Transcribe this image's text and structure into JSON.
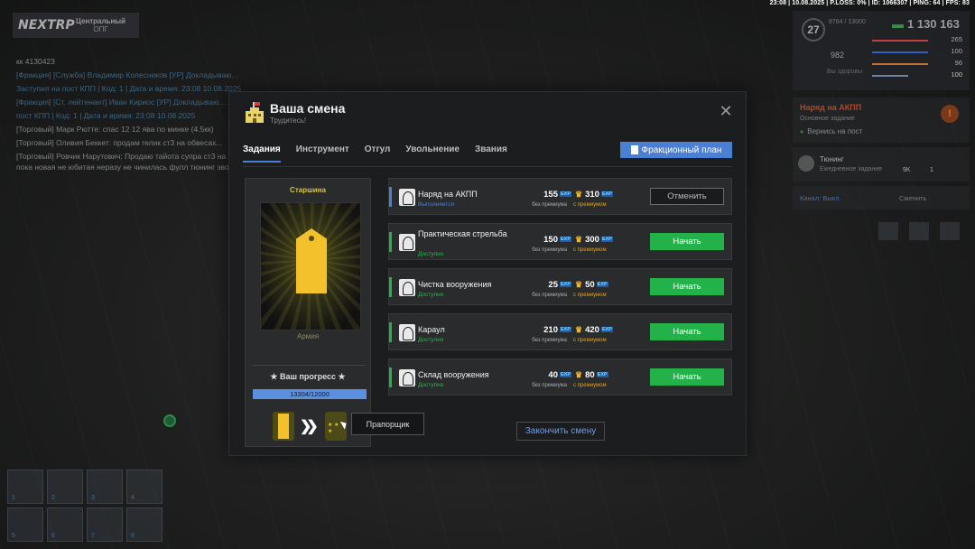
{
  "status": "23:08 | 10.08.2025 | P.LOSS: 0% | ID: 1066307 | PING: 64 | FPS: 83",
  "logo": {
    "text": "NEXTRP",
    "line1": "Центральный",
    "line2": "ОПГ"
  },
  "chat": {
    "lines": [
      {
        "text": "кк 4130423",
        "cls": ""
      },
      {
        "text": "[Фракция] [Служба] Владимир Колесников [УР] Докладываю...",
        "cls": "blue"
      },
      {
        "text": "Заступил на пост КПП | Код: 1 | Дата и время: 23:08 10.08.2025",
        "cls": "blue"
      },
      {
        "text": "[Фракция] [Ст. лейтенант] Иван Кириос [УР] Докладываю...",
        "cls": "blue"
      },
      {
        "text": "пост КПП | Код: 1 | Дата и время: 23:08 10.08.2025",
        "cls": "blue"
      },
      {
        "text": "[Торговый] Марк Рютте: спас 12 12 ява по минке (4.5кк)",
        "cls": ""
      },
      {
        "text": "[Торговый] Оливия Беккет: продам гелик ст3 на обвесах...",
        "cls": ""
      },
      {
        "text": "[Торговый] Ровчик Нарутович: Продаю тайота супра ст3 на обвесе пока новая не юбитая неразу не чинилась фулл тюнинг звоните",
        "cls": ""
      }
    ]
  },
  "hud": {
    "level": "27",
    "level_progress": "8764 / 13000",
    "money": "1 130 163",
    "donate": "982",
    "health_label": "Вы здоровы",
    "stats": [
      "265",
      "100",
      "96",
      "100",
      "100"
    ],
    "stat_colors": [
      "#c04040",
      "#3060c0",
      "#c07030",
      "#7080a0",
      "#7080a0"
    ]
  },
  "task_panel": {
    "title": "Наряд на АКПП",
    "subtitle": "Основное задание",
    "hint": "Вернись на пост"
  },
  "tuning": {
    "title": "Тюнинг",
    "subtitle": "Ежедневное задание",
    "val1": "9K",
    "val2": "1"
  },
  "radio": {
    "channel": "Канал: Выкл.",
    "switch": "Сменить"
  },
  "modal": {
    "title": "Ваша смена",
    "subtitle": "Трудитесь!",
    "close": "✕",
    "tabs": [
      "Задания",
      "Инструмент",
      "Отгул",
      "Увольнение",
      "Звания"
    ],
    "plan_button": "Фракционный план",
    "rank": {
      "name": "Старшина",
      "branch": "Армия",
      "progress_label": "★ Ваш прогресс ★",
      "progress_text": "13304/12000",
      "progress_fraction": 1.0,
      "next_rank_tooltip": "Прапорщик"
    },
    "tasks": [
      {
        "name": "Наряд на АКПП",
        "status": "Выполняется",
        "status_color": "#4a7fd4",
        "stripe": "#4a7fd4",
        "exp": "155",
        "exp_premium": "310",
        "action": "Отменить",
        "action_type": "cancel"
      },
      {
        "name": "Практическая стрельба",
        "status": "Доступно",
        "status_color": "#2fb24f",
        "stripe": "#23b14a",
        "exp": "150",
        "exp_premium": "300",
        "action": "Начать",
        "action_type": "start"
      },
      {
        "name": "Чистка вооружения",
        "status": "Доступно",
        "status_color": "#2fb24f",
        "stripe": "#23b14a",
        "exp": "25",
        "exp_premium": "50",
        "action": "Начать",
        "action_type": "start"
      },
      {
        "name": "Караул",
        "status": "Доступно",
        "status_color": "#2fb24f",
        "stripe": "#23b14a",
        "exp": "210",
        "exp_premium": "420",
        "action": "Начать",
        "action_type": "start"
      },
      {
        "name": "Склад вооружения",
        "status": "Доступно",
        "status_color": "#2fb24f",
        "stripe": "#23b14a",
        "exp": "40",
        "exp_premium": "80",
        "action": "Начать",
        "action_type": "start"
      }
    ],
    "exp_tag": "EXP",
    "no_premium": "без премиума",
    "with_premium": "с премиумом",
    "finish_button": "Закончить смену"
  }
}
